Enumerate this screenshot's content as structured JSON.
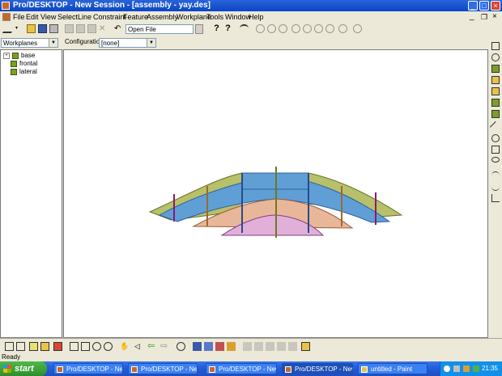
{
  "window": {
    "title": "Pro/DESKTOP - New Session - [assembly - yay.des]"
  },
  "menu": [
    "File",
    "Edit",
    "View",
    "Select",
    "Line",
    "Constraint",
    "Feature",
    "Assembly",
    "Workplane",
    "Tools",
    "Window",
    "Help"
  ],
  "toolbar": {
    "open_file_label": "Open File"
  },
  "selectors": {
    "workplanes_label": "Workplanes",
    "configuration_label": "Configuration:",
    "configuration_value": "[none]"
  },
  "tree": {
    "items": [
      "base",
      "frontal",
      "lateral"
    ]
  },
  "status": {
    "text": "Ready"
  },
  "taskbar": {
    "start_label": "start",
    "tasks": [
      "Pro/DESKTOP - New ...",
      "Pro/DESKTOP - New ...",
      "Pro/DESKTOP - New ...",
      "Pro/DESKTOP - New ...",
      "untitled - Paint"
    ],
    "clock": "21:35"
  },
  "colors": {
    "olive_part": "#b7c06a",
    "blue_part": "#5f9fd6",
    "tan_part": "#e8b79a",
    "pink_part": "#e0b0d8"
  }
}
